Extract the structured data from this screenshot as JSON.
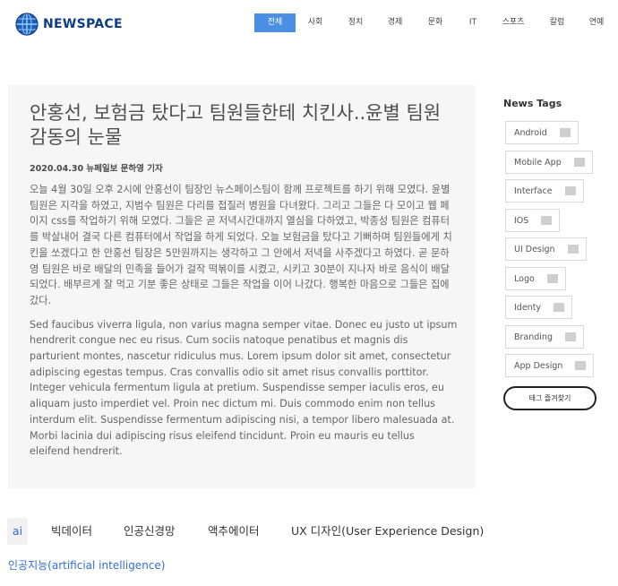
{
  "header": {
    "logo_text": "NEWSPACE",
    "logo_icon": "globe-icon",
    "nav": [
      "전체",
      "사회",
      "정치",
      "경제",
      "문화",
      "IT",
      "스포츠",
      "칼럼",
      "연예"
    ],
    "active_nav": "전체",
    "accent_color": "#4a8fe2"
  },
  "article": {
    "title": "안홍선, 보험금 탔다고 팀원들한테 치킨사..윤별 팀원 감동의 눈물",
    "meta": "2020.04.30 뉴페일보 문하영 기자",
    "paragraphs": [
      "오늘 4월 30일 오후 2시에 안홍선이 팀장인 뉴스페이스팀이 함께 프로젝트를 하기 위해 모였다. 윤별 팀원은 지각을 하였고, 지범수 팀원은 다리를 접질러 병원을 다녀왔다. 그리고 그들은 다 모이고 웹 페이지 css를 작업하기 위해 모였다. 그들은 곧 저녁시간대까지 열심을 다하였고, 박종성 팀원은 컴퓨터를 박살내어 결국 다른 컴퓨터에서 작업을 하게 되었다. 오늘 보험금을 탔다고 기뻐하며 팀원들에게 치킨을 쏘겠다고 한 안홍선 팀장은 5만원까지는 생각하고 그 안에서 저녁을 사주겠다고 하였다. 곧 문하영 팀원은 바로 배달의 민족을 들어가 걸작 떡볶이를 시켰고, 시키고 30분이 지나자 바로 음식이 배달되었다. 배부르게 잘 먹고 기분 좋은 상태로 그들은 작업을 이어 나갔다. 행복한 마음으로 그들은 집에 갔다.",
      "Sed faucibus viverra ligula, non varius magna semper vitae. Donec eu justo ut ipsum hendrerit congue nec eu risus. Cum sociis natoque penatibus et magnis dis parturient montes, nascetur ridiculus mus. Lorem ipsum dolor sit amet, consectetur adipiscing egestas tempus. Cras convallis odio sit amet risus convallis porttitor. Integer vehicula fermentum ligula at pretium. Suspendisse semper iaculis eros, eu aliquam justo imperdiet vel. Proin nec dictum mi. Duis commodo enim non tellus interdum elit. Suspendisse fermentum adipiscing nisi, a tempor libero malesuada at. Morbi lacinia dui adipiscing risus eleifend tincidunt. Proin eu mauris eu tellus eleifend hendrerit."
    ]
  },
  "tags": {
    "title": "News Tags",
    "items": [
      "Android",
      "Mobile App",
      "Interface",
      "IOS",
      "UI Design",
      "Logo",
      "Identy",
      "Branding",
      "App Design"
    ],
    "button_label": "태그 즐겨찾기"
  },
  "keywords": {
    "tabs": [
      "ai",
      "빅데이터",
      "인공신경망",
      "액추에이터",
      "UX 디자인(User Experience Design)"
    ],
    "active_tab": "ai",
    "link": "인공지능(artificial intelligence)"
  }
}
